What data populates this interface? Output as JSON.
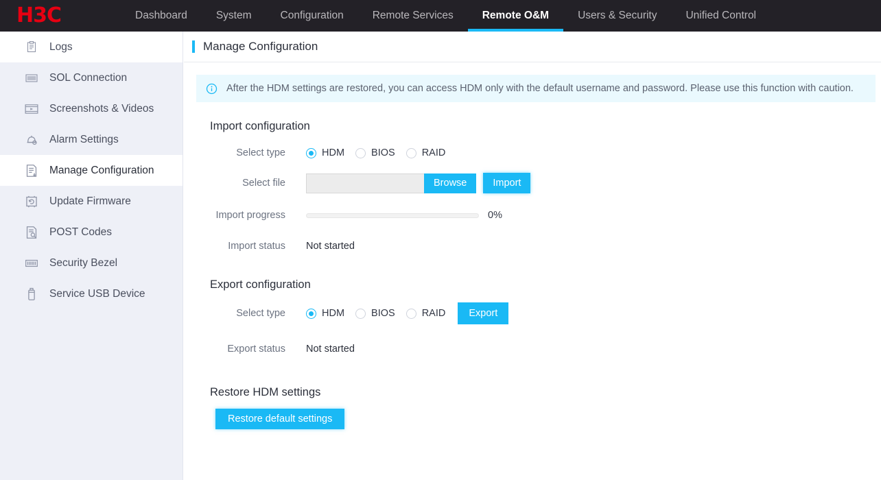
{
  "brand": {
    "logo_text": "H3C",
    "logo_color": "#e60012",
    "accent": "#1ab9f5"
  },
  "topnav": {
    "items": [
      {
        "label": "Dashboard",
        "active": false
      },
      {
        "label": "System",
        "active": false
      },
      {
        "label": "Configuration",
        "active": false
      },
      {
        "label": "Remote Services",
        "active": false
      },
      {
        "label": "Remote O&M",
        "active": true
      },
      {
        "label": "Users & Security",
        "active": false
      },
      {
        "label": "Unified Control",
        "active": false
      }
    ]
  },
  "sidebar": {
    "items": [
      {
        "label": "Logs",
        "icon": "clipboard-icon",
        "state": "plain"
      },
      {
        "label": "SOL Connection",
        "icon": "sol-icon",
        "state": "normal"
      },
      {
        "label": "Screenshots & Videos",
        "icon": "video-icon",
        "state": "normal"
      },
      {
        "label": "Alarm Settings",
        "icon": "bell-icon",
        "state": "normal"
      },
      {
        "label": "Manage Configuration",
        "icon": "config-doc-icon",
        "state": "active"
      },
      {
        "label": "Update Firmware",
        "icon": "firmware-chip-icon",
        "state": "normal"
      },
      {
        "label": "POST Codes",
        "icon": "doc-search-icon",
        "state": "normal"
      },
      {
        "label": "Security Bezel",
        "icon": "bezel-icon",
        "state": "normal"
      },
      {
        "label": "Service USB Device",
        "icon": "usb-icon",
        "state": "normal"
      }
    ]
  },
  "page": {
    "title": "Manage Configuration",
    "banner": {
      "icon": "info-circle-icon",
      "text": "After the HDM settings are restored, you can access HDM only with the default username and password. Please use this function with caution."
    }
  },
  "import": {
    "section_title": "Import configuration",
    "select_type_label": "Select type",
    "type_options": [
      {
        "label": "HDM",
        "checked": true
      },
      {
        "label": "BIOS",
        "checked": false
      },
      {
        "label": "RAID",
        "checked": false
      }
    ],
    "select_file_label": "Select file",
    "file_value": "",
    "browse_label": "Browse",
    "import_label": "Import",
    "progress_label": "Import progress",
    "progress_percent": "0%",
    "progress_value": 0,
    "status_label": "Import status",
    "status_value": "Not started"
  },
  "export": {
    "section_title": "Export configuration",
    "select_type_label": "Select type",
    "type_options": [
      {
        "label": "HDM",
        "checked": true
      },
      {
        "label": "BIOS",
        "checked": false
      },
      {
        "label": "RAID",
        "checked": false
      }
    ],
    "export_label": "Export",
    "status_label": "Export status",
    "status_value": "Not started"
  },
  "restore": {
    "section_title": "Restore HDM settings",
    "button_label": "Restore default settings"
  }
}
